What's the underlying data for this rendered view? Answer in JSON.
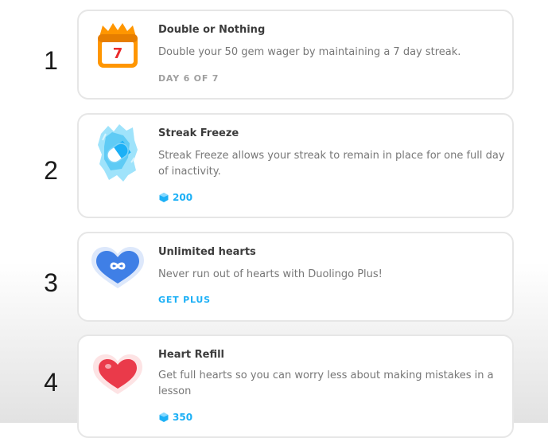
{
  "items": [
    {
      "number": "1",
      "title": "Double or Nothing",
      "description": "Double your 50 gem wager by maintaining a 7 day streak.",
      "status": "DAY 6 OF 7",
      "icon": "calendar-fire-icon",
      "calendar_day": "7"
    },
    {
      "number": "2",
      "title": "Streak Freeze",
      "description": "Streak Freeze allows your streak to remain in place for one full day of inactivity.",
      "price": "200",
      "icon": "streak-freeze-icon"
    },
    {
      "number": "3",
      "title": "Unlimited hearts",
      "description": "Never run out of hearts with Duolingo Plus!",
      "action": "GET PLUS",
      "icon": "infinity-heart-icon"
    },
    {
      "number": "4",
      "title": "Heart Refill",
      "description": "Get full hearts so you can worry less about making mistakes in a lesson",
      "price": "350",
      "icon": "heart-icon"
    }
  ],
  "colors": {
    "accent_blue": "#1cb0f6",
    "calendar_orange": "#ff9600",
    "calendar_red": "#ea2b2b",
    "heart_blue": "#3f7fe6",
    "heart_red": "#ea3a4a",
    "card_border": "#e6e6e6"
  }
}
